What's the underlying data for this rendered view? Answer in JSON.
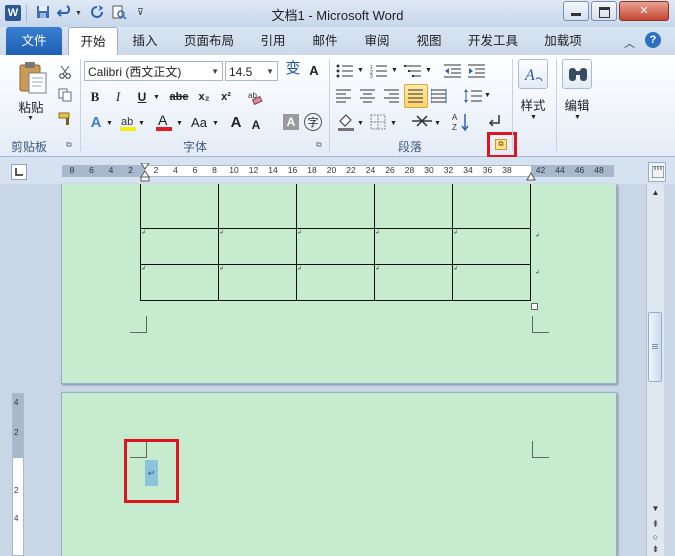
{
  "window": {
    "title": "文档1 - Microsoft Word",
    "app_icon": "W",
    "controls": {
      "minimize": "▭",
      "maximize": "□",
      "close": "✕"
    }
  },
  "tabs": [
    {
      "label": "文件"
    },
    {
      "label": "开始"
    },
    {
      "label": "插入"
    },
    {
      "label": "页面布局"
    },
    {
      "label": "引用"
    },
    {
      "label": "邮件"
    },
    {
      "label": "审阅"
    },
    {
      "label": "视图"
    },
    {
      "label": "开发工具"
    },
    {
      "label": "加载项"
    }
  ],
  "active_tab": "开始",
  "ribbon": {
    "clipboard": {
      "label": "剪贴板",
      "paste_label": "粘贴"
    },
    "font": {
      "label": "字体",
      "font_name": "Calibri (西文正文)",
      "font_size": "14.5",
      "pinyin_glyph": "变",
      "bold": "B",
      "italic": "I",
      "underline": "U",
      "strike": "abe",
      "subscript": "x₂",
      "superscript": "x²",
      "grow": "A",
      "shrink": "A",
      "case": "Aa",
      "char_shade": "A",
      "enclose": "字"
    },
    "paragraph": {
      "label": "段落"
    },
    "styles": {
      "label": "样式"
    },
    "editing": {
      "label": "编辑"
    }
  },
  "ruler": {
    "numbers": [
      "8",
      "6",
      "4",
      "2",
      "2",
      "4",
      "6",
      "8",
      "10",
      "12",
      "14",
      "16",
      "18",
      "20",
      "22",
      "24",
      "26",
      "28",
      "30",
      "32",
      "34",
      "36",
      "38",
      "42",
      "44",
      "46",
      "48"
    ],
    "vertical_numbers": [
      "4",
      "2",
      "2",
      "4"
    ]
  },
  "document": {
    "table_rows": 3,
    "table_cols": 5,
    "cell_mark": "↲",
    "paragraph_mark": "↵"
  },
  "highlights": {
    "paragraph_launcher_boxed": true,
    "cursor_paragraph_boxed": true,
    "box_color": "#e0141c"
  }
}
